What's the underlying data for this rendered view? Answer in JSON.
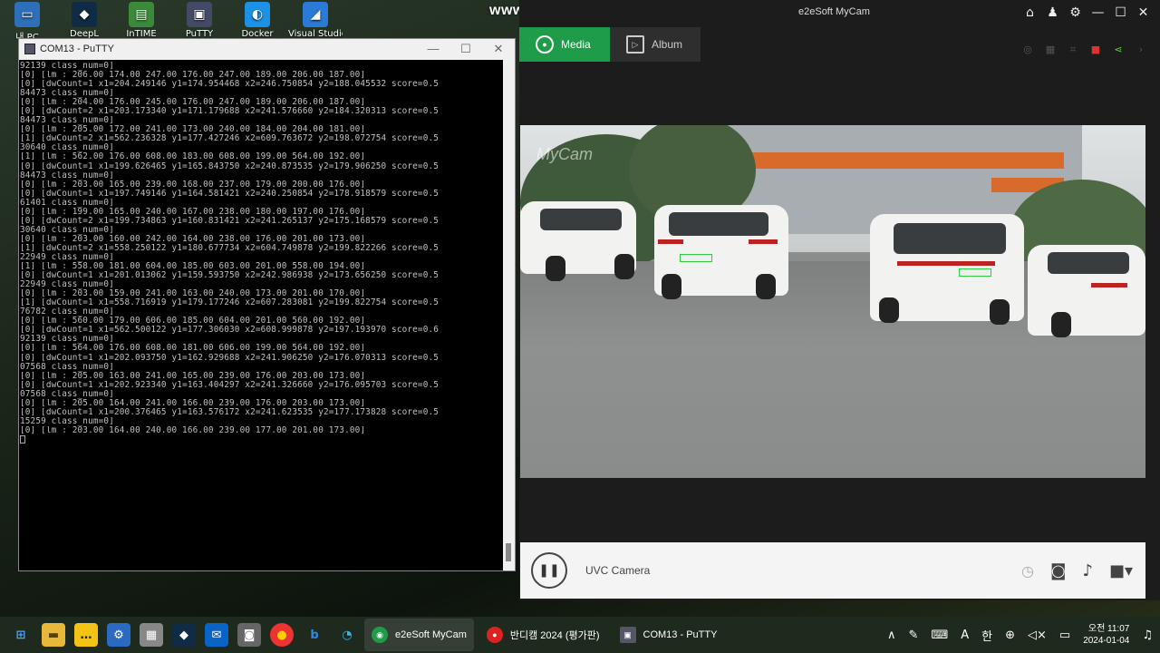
{
  "desktop": {
    "icons": [
      {
        "label": "내 PC",
        "glyph": "▭",
        "bg": "#2d6fb8"
      },
      {
        "label": "DeepL",
        "glyph": "◆",
        "bg": "#0f2b46"
      },
      {
        "label": "InTIME",
        "glyph": "▤",
        "bg": "#3a8a3a"
      },
      {
        "label": "PuTTY",
        "glyph": "▣",
        "bg": "#444a66"
      },
      {
        "label": "Docker",
        "glyph": "◐",
        "bg": "#1d91e6"
      },
      {
        "label": "Visual Studio",
        "glyph": "◢",
        "bg": "#2a7ad6"
      }
    ]
  },
  "watermark": "www.BANDICAM.com",
  "putty": {
    "title": "COM13 - PuTTY",
    "lines": [
      "92139 class_num=0]",
      "[0] [lm : 206.00 174.00 247.00 176.00 247.00 189.00 206.00 187.00]",
      "[0] [dwCount=1 x1=204.249146 y1=174.954468 x2=246.750854 y2=188.045532 score=0.5",
      "84473 class_num=0]",
      "[0] [lm : 204.00 176.00 245.00 176.00 247.00 189.00 206.00 187.00]",
      "[0] [dwCount=2 x1=203.173340 y1=171.179688 x2=241.576660 y2=184.320313 score=0.5",
      "84473 class_num=0]",
      "[0] [lm : 205.00 172.00 241.00 173.00 240.00 184.00 204.00 181.00]",
      "[1] [dwCount=2 x1=562.236328 y1=177.427246 x2=609.763672 y2=198.072754 score=0.5",
      "30640 class_num=0]",
      "[1] [lm : 562.00 176.00 608.00 183.00 608.00 199.00 564.00 192.00]",
      "[0] [dwCount=1 x1=199.626465 y1=165.843750 x2=240.873535 y2=179.906250 score=0.5",
      "84473 class_num=0]",
      "[0] [lm : 203.00 165.00 239.00 168.00 237.00 179.00 200.00 176.00]",
      "[0] [dwCount=1 x1=197.749146 y1=164.581421 x2=240.250854 y2=178.918579 score=0.5",
      "61401 class_num=0]",
      "[0] [lm : 199.00 165.00 240.00 167.00 238.00 180.00 197.00 176.00]",
      "[0] [dwCount=2 x1=199.734863 y1=160.831421 x2=241.265137 y2=175.168579 score=0.5",
      "30640 class_num=0]",
      "[0] [lm : 203.00 160.00 242.00 164.00 238.00 176.00 201.00 173.00]",
      "[1] [dwCount=2 x1=558.250122 y1=180.677734 x2=604.749878 y2=199.822266 score=0.5",
      "22949 class_num=0]",
      "[1] [lm : 558.00 181.00 604.00 185.00 603.00 201.00 558.00 194.00]",
      "[0] [dwCount=1 x1=201.013062 y1=159.593750 x2=242.986938 y2=173.656250 score=0.5",
      "22949 class_num=0]",
      "[0] [lm : 203.00 159.00 241.00 163.00 240.00 173.00 201.00 170.00]",
      "[1] [dwCount=1 x1=558.716919 y1=179.177246 x2=607.283081 y2=199.822754 score=0.5",
      "76782 class_num=0]",
      "[0] [lm : 560.00 179.00 606.00 185.00 604.00 201.00 560.00 192.00]",
      "[0] [dwCount=1 x1=562.500122 y1=177.306030 x2=608.999878 y2=197.193970 score=0.6",
      "92139 class_num=0]",
      "[0] [lm : 564.00 176.00 608.00 181.00 606.00 199.00 564.00 192.00]",
      "[0] [dwCount=1 x1=202.093750 y1=162.929688 x2=241.906250 y2=176.070313 score=0.5",
      "07568 class_num=0]",
      "[0] [lm : 205.00 163.00 241.00 165.00 239.00 176.00 203.00 173.00]",
      "[0] [dwCount=1 x1=202.923340 y1=163.404297 x2=241.326660 y2=176.095703 score=0.5",
      "07568 class_num=0]",
      "[0] [lm : 205.00 164.00 241.00 166.00 239.00 176.00 203.00 173.00]",
      "[0] [dwCount=1 x1=200.376465 y1=163.576172 x2=241.623535 y2=177.173828 score=0.5",
      "15259 class_num=0]",
      "[0] [lm : 203.00 164.00 240.00 166.00 239.00 177.00 201.00 173.00]"
    ]
  },
  "mycam": {
    "title": "e2eSoft MyCam",
    "tabs": [
      {
        "label": "Media",
        "active": true
      },
      {
        "label": "Album",
        "active": false
      }
    ],
    "video_watermark": "MyCam",
    "plates": [
      "12다3456",
      "12가3456"
    ],
    "camera_name": "UVC Camera",
    "accent": "#1f9c4a"
  },
  "taskbar": {
    "apps": [
      {
        "label": "e2eSoft MyCam",
        "active": true,
        "color": "#1f9c4a"
      },
      {
        "label": "반디캠 2024 (평가판)",
        "active": false,
        "color": "#d22"
      },
      {
        "label": "COM13 - PuTTY",
        "active": false,
        "color": "#556"
      }
    ],
    "ime_lang": "한",
    "ime_mode": "A",
    "time": "오전 11:07",
    "date": "2024-01-04"
  }
}
